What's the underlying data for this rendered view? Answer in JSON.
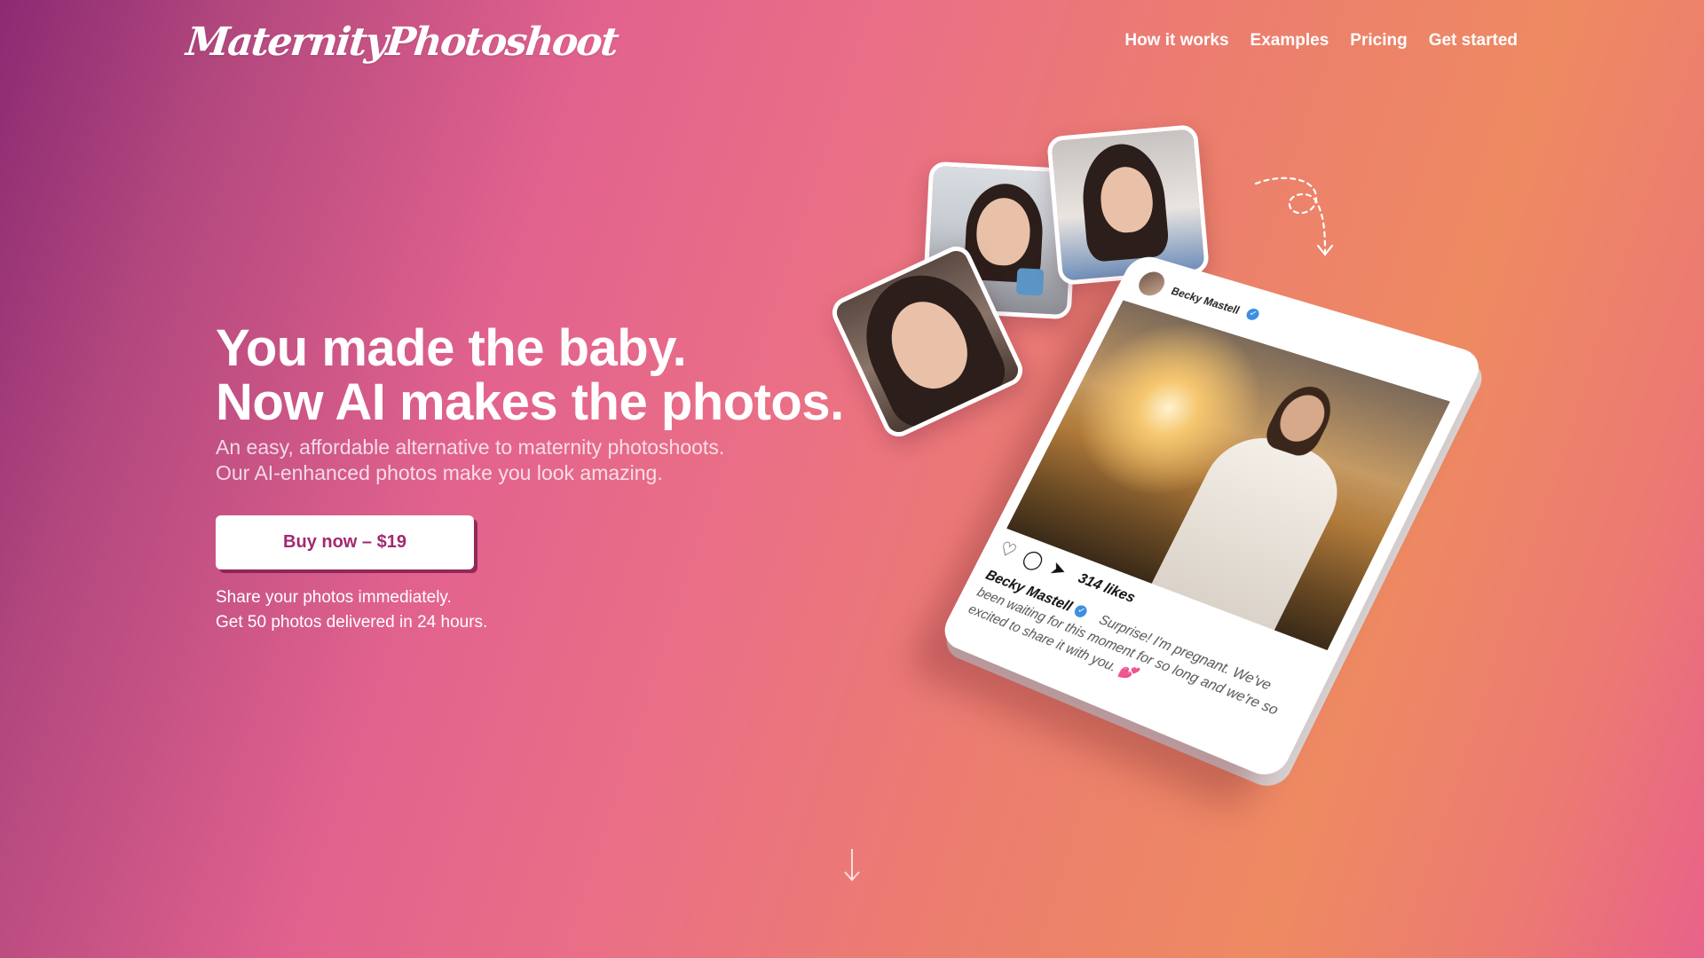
{
  "brand": {
    "logo_text": "MaternityPhotoshoot"
  },
  "nav": {
    "items": [
      {
        "label": "How it works"
      },
      {
        "label": "Examples"
      },
      {
        "label": "Pricing"
      },
      {
        "label": "Get started"
      }
    ]
  },
  "hero": {
    "headline_line1": "You made the baby.",
    "headline_line2": "Now AI makes the photos.",
    "sub_line1": "An easy, affordable alternative to maternity photoshoots.",
    "sub_line2": "Our AI-enhanced photos make you look amazing.",
    "cta_label": "Buy now – $19",
    "note_line1": "Share your photos immediately.",
    "note_line2": "Get 50 photos delivered in 24 hours."
  },
  "post": {
    "username": "Becky Mastell",
    "likes": "314 likes",
    "caption": "Surprise! I'm pregnant. We've been waiting for this moment for so long and we're so excited to share it with you. 💕"
  },
  "icons": {
    "verified": "verified-badge-icon",
    "like": "heart-icon",
    "comment": "comment-icon",
    "share": "send-icon",
    "scroll": "arrow-down-icon"
  },
  "colors": {
    "cta_text": "#a2296f",
    "verified": "#3d8fe0"
  }
}
